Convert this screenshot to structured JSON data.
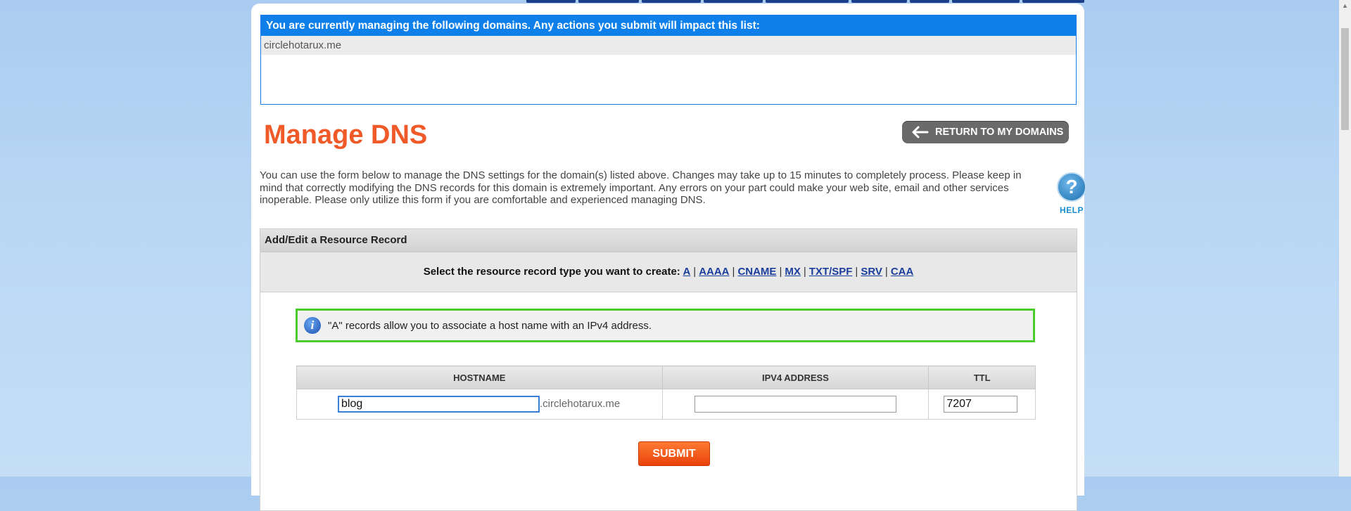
{
  "managed_domains": {
    "header": "You are currently managing the following domains. Any actions you submit will impact this list:",
    "items": [
      "circlehotarux.me"
    ]
  },
  "page_title": "Manage DNS",
  "return_button": {
    "label": "RETURN TO MY DOMAINS",
    "icon": "arrow-left-icon"
  },
  "description": "You can use the form below to manage the DNS settings for the domain(s) listed above. Changes may take up to 15 minutes to completely process. Please keep in mind that correctly modifying the DNS records for this domain is extremely important. Any errors on your part could make your web site, email and other services inoperable. Please only utilize this form if you are comfortable and experienced managing DNS.",
  "help": {
    "label": "HELP",
    "icon": "question-icon"
  },
  "resource_record": {
    "header": "Add/Edit a Resource Record",
    "select_prompt": "Select the resource record type you want to create:",
    "types": [
      "A",
      "AAAA",
      "CNAME",
      "MX",
      "TXT/SPF",
      "SRV",
      "CAA"
    ],
    "info_text": "\"A\" records allow you to associate a host name with an IPv4 address.",
    "columns": [
      "HOSTNAME",
      "IPV4 ADDRESS",
      "TTL"
    ],
    "hostname_value": "blog",
    "domain_suffix": ".circlehotarux.me",
    "ipv4_value": "",
    "ttl_value": "7207",
    "submit_label": "SUBMIT"
  },
  "colors": {
    "title": "#f05a28",
    "header_blue": "#0f80ea",
    "info_border": "#4ccb2c",
    "submit": "#f05a1a"
  }
}
